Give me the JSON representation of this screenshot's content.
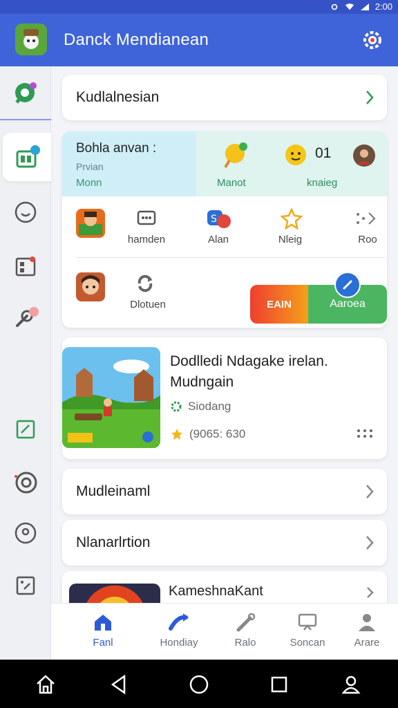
{
  "status_bar": {
    "time": "2:00"
  },
  "app_bar": {
    "title": "Danck Mendianean"
  },
  "rows": {
    "top": "Kudlalnesian",
    "second": "Mudleinaml",
    "third": "Nlanarlrtion"
  },
  "stats": {
    "title": "Bohla anvan :",
    "subtitle": "Prvian",
    "subtitle2": "Monn",
    "col1_label": "Manot",
    "col2_value": "01",
    "col2_label": "knaieg"
  },
  "grid": {
    "items": [
      {
        "label": "hamden",
        "icon": "dialog-icon"
      },
      {
        "label": "Alan",
        "icon": "app-s-icon"
      },
      {
        "label": "Nleig",
        "icon": "star-outline-icon"
      },
      {
        "label": "Roo",
        "icon": "more-arrow-icon"
      }
    ],
    "second_row_label": "Dlotuen"
  },
  "earn": {
    "left_label": "EAIN",
    "right_label": "Aaroea"
  },
  "game": {
    "title": "Dodlledi Ndagake irelan. Mudngain",
    "meta1": "Siodang",
    "meta2": "(9065: 630"
  },
  "partial_card": {
    "title": "KameshnaKant"
  },
  "bottom_nav": [
    {
      "label": "Fanl",
      "icon": "home-icon"
    },
    {
      "label": "Hondiay",
      "icon": "share-icon"
    },
    {
      "label": "Ralo",
      "icon": "tools-icon"
    },
    {
      "label": "Soncan",
      "icon": "screen-icon"
    },
    {
      "label": "Arare",
      "icon": "person-icon"
    }
  ],
  "colors": {
    "primary": "#3f63d8",
    "accent_green": "#4cb561",
    "earn_orange": "#ef3e2f"
  }
}
